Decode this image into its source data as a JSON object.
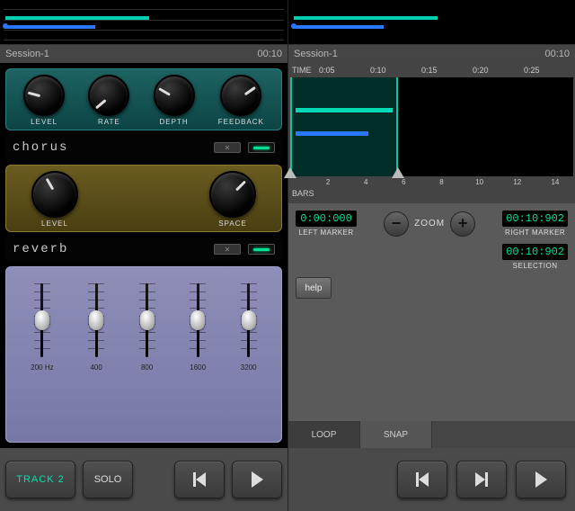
{
  "left": {
    "session_name": "Session-1",
    "session_time": "00:10",
    "chorus": {
      "title": "chorus",
      "knobs": [
        {
          "label": "LEVEL",
          "angle": -75
        },
        {
          "label": "RATE",
          "angle": -130
        },
        {
          "label": "DEPTH",
          "angle": -60
        },
        {
          "label": "FEEDBACK",
          "angle": 55
        }
      ]
    },
    "reverb": {
      "title": "reverb",
      "knobs": [
        {
          "label": "LEVEL",
          "angle": -30
        },
        {
          "label": "SPACE",
          "angle": 45
        }
      ]
    },
    "eq": {
      "bands": [
        {
          "label": "200 Hz",
          "pos": 0.5
        },
        {
          "label": "400",
          "pos": 0.5
        },
        {
          "label": "800",
          "pos": 0.5
        },
        {
          "label": "1600",
          "pos": 0.5
        },
        {
          "label": "3200",
          "pos": 0.5
        }
      ]
    },
    "track_button": "TRACK 2",
    "solo_button": "SOLO"
  },
  "right": {
    "session_name": "Session-1",
    "session_time": "00:10",
    "time_label": "TIME",
    "time_ticks": [
      "0:05",
      "0:10",
      "0:15",
      "0:20",
      "0:25"
    ],
    "bar_ticks": [
      "2",
      "4",
      "6",
      "8",
      "10",
      "12",
      "14"
    ],
    "bars_label": "BARS",
    "left_marker": {
      "value": "0:00:000",
      "label": "LEFT MARKER"
    },
    "right_marker": {
      "value": "00:10:902",
      "label": "RIGHT MARKER"
    },
    "selection": {
      "value": "00:10:902",
      "label": "SELECTION"
    },
    "zoom_label": "ZOOM",
    "help_label": "help",
    "tabs": {
      "loop": "LOOP",
      "snap": "SNAP"
    }
  }
}
